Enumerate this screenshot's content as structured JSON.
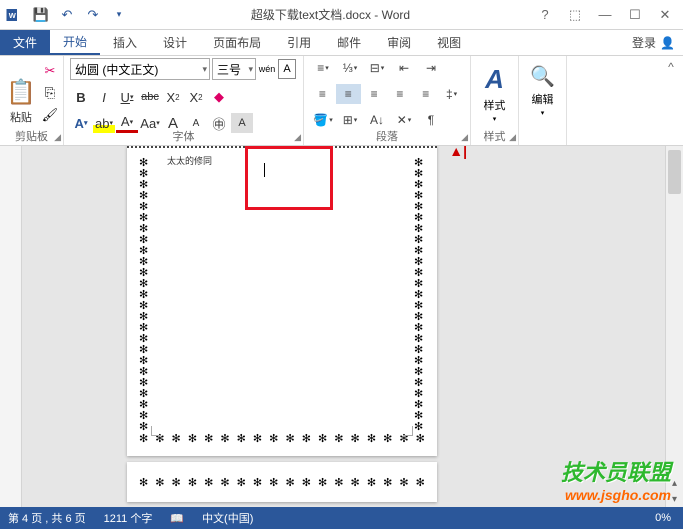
{
  "title": "超级下载text文档.docx - Word",
  "tabs": {
    "file": "文件",
    "home": "开始",
    "insert": "插入",
    "design": "设计",
    "layout": "页面布局",
    "references": "引用",
    "mailings": "邮件",
    "review": "审阅",
    "view": "视图"
  },
  "login": "登录",
  "ribbon": {
    "clipboard": {
      "label": "剪贴板",
      "paste": "粘贴"
    },
    "font": {
      "label": "字体",
      "name": "幼圆 (中文正文)",
      "size": "三号",
      "wen": "wén",
      "bold": "B",
      "italic": "I",
      "underline": "U",
      "strike": "abc",
      "sub": "X₂",
      "sup": "X²",
      "grow": "A",
      "shrink": "A",
      "clear": "Aa",
      "hl": "A",
      "color": "A",
      "ring": "A"
    },
    "paragraph": {
      "label": "段落"
    },
    "styles": {
      "label": "样式",
      "btn": "样式"
    },
    "editing": {
      "label": "编辑",
      "btn": "编辑"
    }
  },
  "document": {
    "small_text": "太太的修同",
    "track_glyph": "▲|"
  },
  "status": {
    "page": "第 4 页 , 共 6 页",
    "words": "1211 个字",
    "lang": "中文(中国)",
    "zoom": "0%"
  },
  "watermark": {
    "line1": "技术员联盟",
    "line2": "www.jsgho.com"
  }
}
